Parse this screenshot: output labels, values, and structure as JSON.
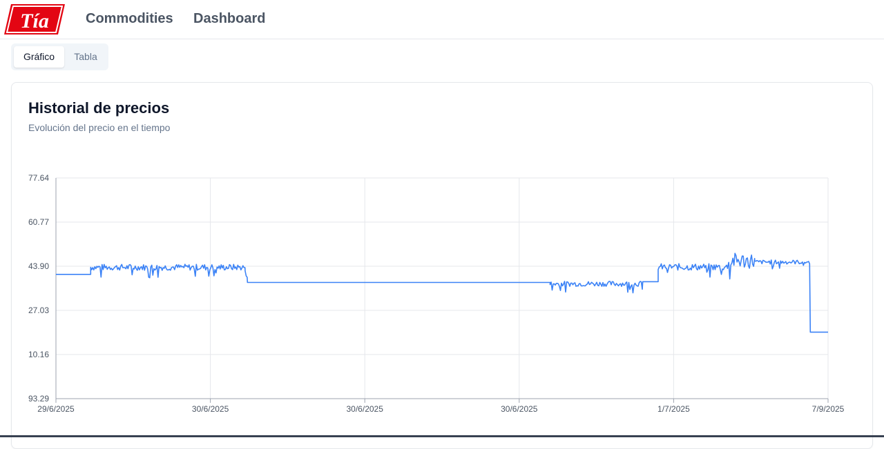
{
  "nav": {
    "items": [
      "Commodities",
      "Dashboard"
    ]
  },
  "tabs": [
    {
      "label": "Gráfico",
      "active": true
    },
    {
      "label": "Tabla",
      "active": false
    }
  ],
  "card": {
    "title": "Historial de precios",
    "subtitle": "Evolución del precio en el tiempo"
  },
  "colors": {
    "line": "#3b82f6",
    "grid": "#e5e7eb",
    "brand": "#e30613"
  },
  "chart_data": {
    "type": "line",
    "title": "",
    "xlabel": "",
    "ylabel": "",
    "y_ticks": [
      "93.29",
      "10.16",
      "27.03",
      "43.90",
      "60.77",
      "77.64"
    ],
    "x_ticks": [
      "29/6/2025",
      "30/6/2025",
      "30/6/2025",
      "30/6/2025",
      "1/7/2025",
      "7/9/2025"
    ],
    "ylim": [
      -6.71,
      77.64
    ],
    "grid": true,
    "series": [
      {
        "segments": [
          {
            "from": 0.0,
            "to": 0.045,
            "base": 40.8,
            "noise": 0
          },
          {
            "from": 0.045,
            "to": 0.245,
            "base": 43.5,
            "noise": 1.2
          },
          {
            "from": 0.245,
            "to": 0.248,
            "base": 41.0,
            "noise": 1.5
          },
          {
            "from": 0.248,
            "to": 0.64,
            "base": 37.7,
            "noise": 0
          },
          {
            "from": 0.64,
            "to": 0.76,
            "base": 37.2,
            "noise": 1.0
          },
          {
            "from": 0.76,
            "to": 0.78,
            "base": 38.0,
            "noise": 0
          },
          {
            "from": 0.78,
            "to": 0.87,
            "base": 43.6,
            "noise": 1.3
          },
          {
            "from": 0.87,
            "to": 0.905,
            "base": 46.0,
            "noise": 3.0
          },
          {
            "from": 0.905,
            "to": 0.977,
            "base": 45.5,
            "noise": 0.8
          },
          {
            "from": 0.977,
            "to": 1.0,
            "base": 18.7,
            "noise": 0
          }
        ]
      }
    ]
  }
}
